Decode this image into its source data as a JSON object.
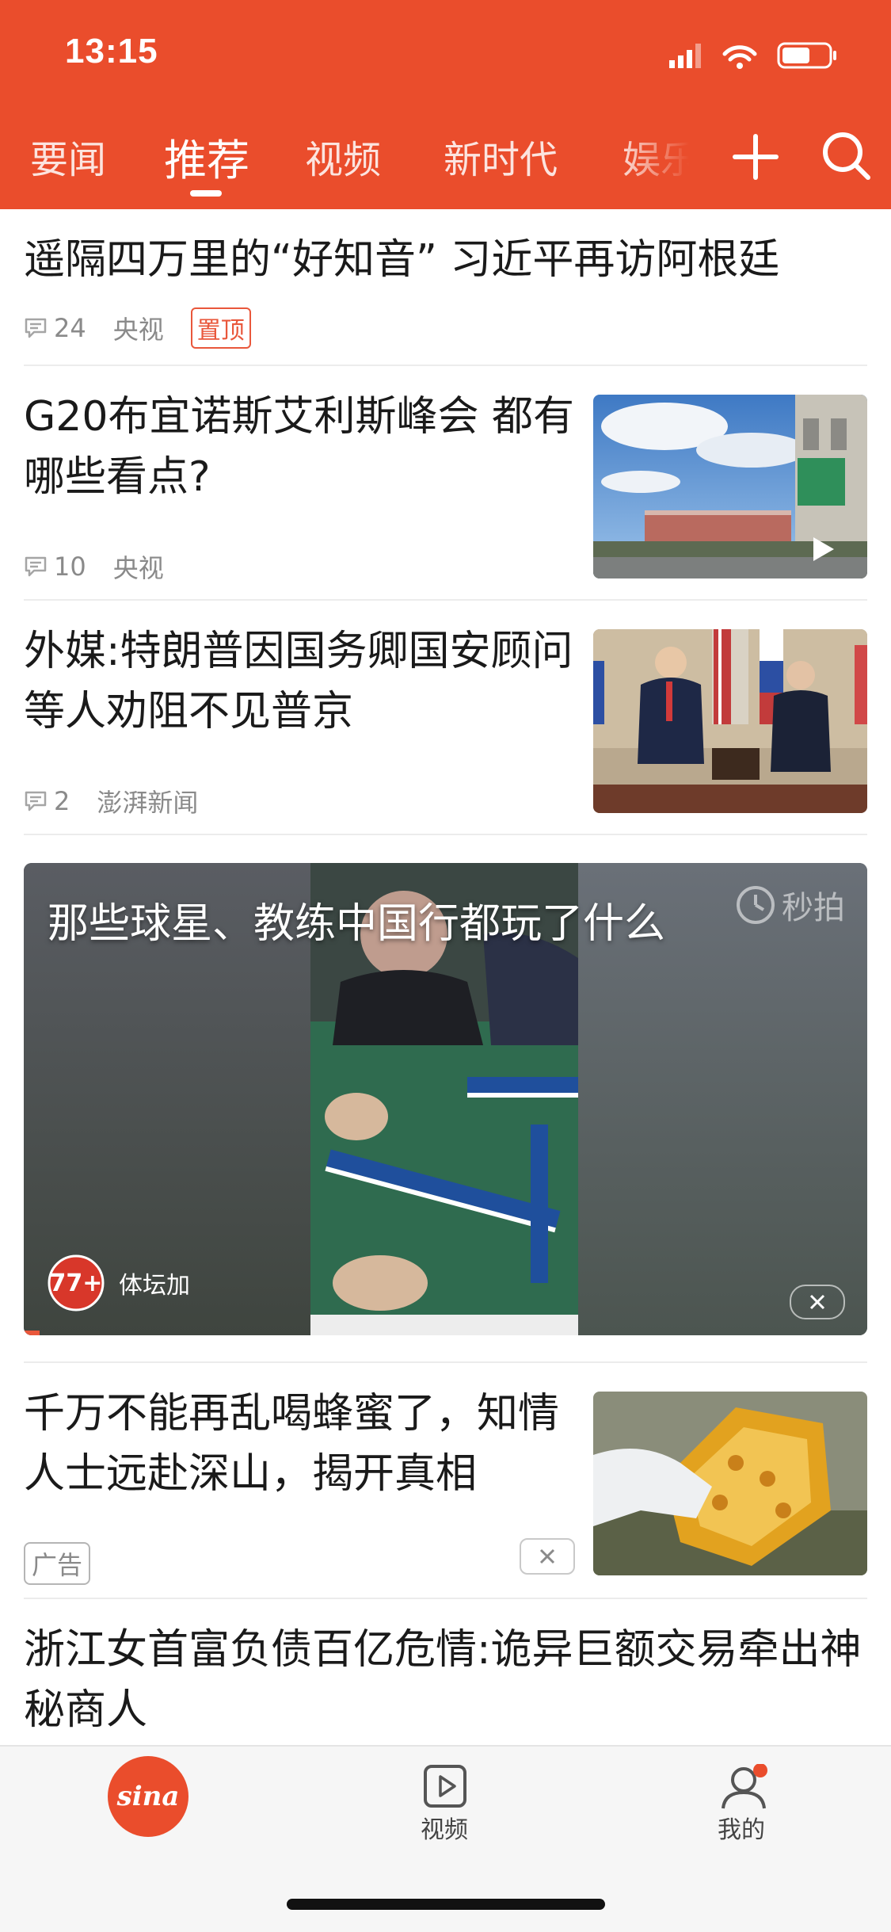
{
  "status_bar": {
    "time": "13:15"
  },
  "tabs": [
    {
      "label": "要闻",
      "active": false
    },
    {
      "label": "推荐",
      "active": true
    },
    {
      "label": "视频",
      "active": false
    },
    {
      "label": "新时代",
      "active": false
    },
    {
      "label": "娱乐",
      "active": false
    }
  ],
  "header_icons": [
    "add-channel-icon",
    "search-icon"
  ],
  "feed": {
    "item1": {
      "title": "遥隔四万里的“好知音” 习近平再访阿根廷",
      "comments": "24",
      "source": "央视",
      "badge": "置顶"
    },
    "item2": {
      "title": "G20布宜诺斯艾利斯峰会 都有哪些看点?",
      "comments": "10",
      "source": "央视",
      "thumb": "video"
    },
    "item3": {
      "title": "外媒:特朗普因国务卿国安顾问等人劝阻不见普京",
      "comments": "2",
      "source": "澎湃新闻"
    },
    "video": {
      "title": "那些球星、教练中国行都玩了什么",
      "source": "体坛加",
      "watermark": "秒拍"
    },
    "ad": {
      "title": "千万不能再乱喝蜂蜜了，知情人士远赴深山，揭开真相",
      "badge": "广告"
    },
    "item5": {
      "title": "浙江女首富负债百亿危情:诡异巨额交易牵出神秘商人"
    }
  },
  "bottom_nav": {
    "home_logo": "sina",
    "video_label": "视频",
    "me_label": "我的"
  },
  "colors": {
    "brand": "#ea4d2c",
    "badge": "#e9573b"
  }
}
